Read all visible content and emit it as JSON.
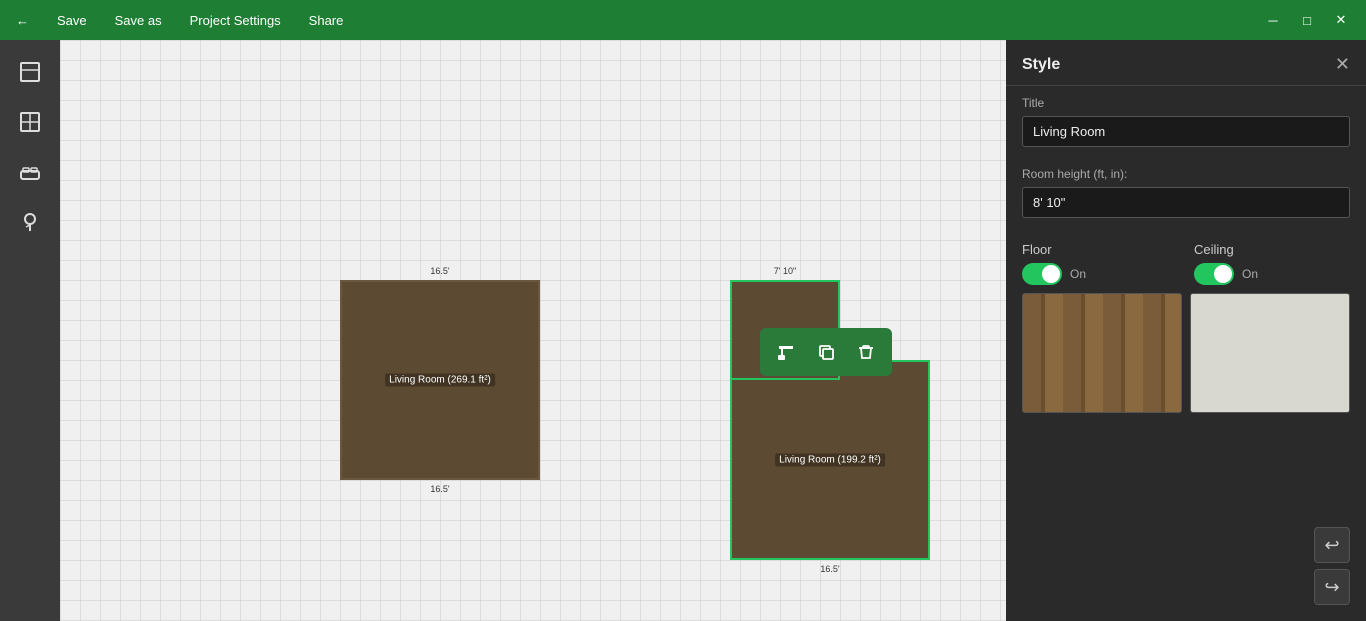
{
  "titlebar": {
    "back_label": "←",
    "save_label": "Save",
    "save_as_label": "Save as",
    "project_settings_label": "Project Settings",
    "share_label": "Share",
    "minimize_label": "─",
    "maximize_label": "□",
    "close_label": "✕"
  },
  "left_toolbar": {
    "tools": [
      {
        "name": "room-tool",
        "icon": "⬜",
        "label": "Room"
      },
      {
        "name": "window-tool",
        "icon": "⊞",
        "label": "Window"
      },
      {
        "name": "furniture-tool",
        "icon": "🛋",
        "label": "Furniture"
      },
      {
        "name": "plant-tool",
        "icon": "🌳",
        "label": "Plant"
      }
    ]
  },
  "canvas": {
    "room1": {
      "label": "Living Room (269.1 ft²)",
      "measure_top": "16.5'",
      "measure_bottom": "16.5'"
    },
    "room2": {
      "label": "Living Room (199.2 ft²)",
      "measure_top": "7' 10\"",
      "measure_bottom": "16.5'"
    }
  },
  "floating_toolbar": {
    "paint_icon": "🖌",
    "copy_icon": "⧉",
    "delete_icon": "🗑"
  },
  "style_panel": {
    "title": "Style",
    "close_icon": "✕",
    "title_label": "Title",
    "title_value": "Living Room",
    "room_height_label": "Room height (ft, in):",
    "room_height_value": "8' 10\"",
    "floor_label": "Floor",
    "floor_toggle": "On",
    "ceiling_label": "Ceiling",
    "ceiling_toggle": "On"
  },
  "undo_redo": {
    "undo_icon": "↩",
    "redo_icon": "↪"
  }
}
